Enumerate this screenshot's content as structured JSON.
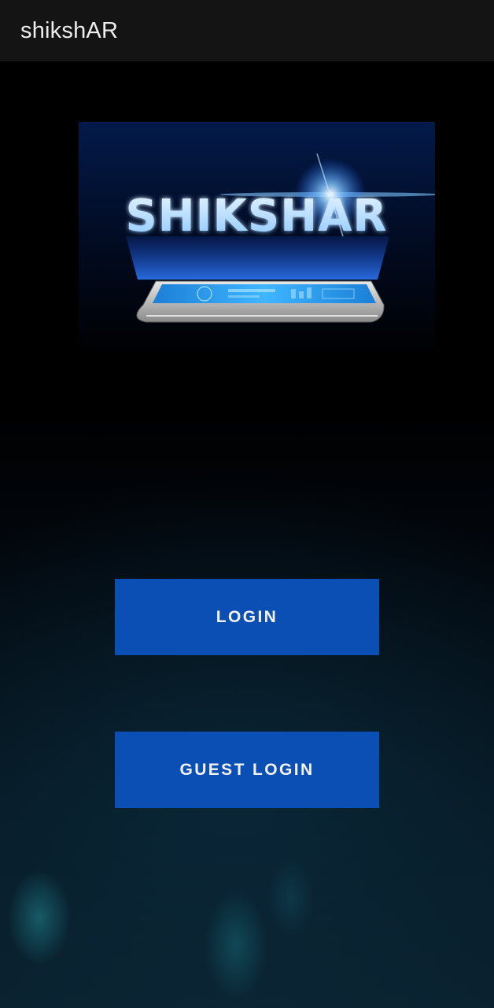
{
  "app_bar": {
    "title": "shikshAR"
  },
  "logo": {
    "text": "SHIKSHAR",
    "icon": "phone-hologram-logo",
    "glow_color": "#2f7cff"
  },
  "buttons": {
    "login_label": "LOGIN",
    "guest_login_label": "GUEST LOGIN"
  },
  "colors": {
    "app_bar_bg": "#141414",
    "button_bg": "#0b4fb5",
    "button_text": "#f2f2f2"
  }
}
